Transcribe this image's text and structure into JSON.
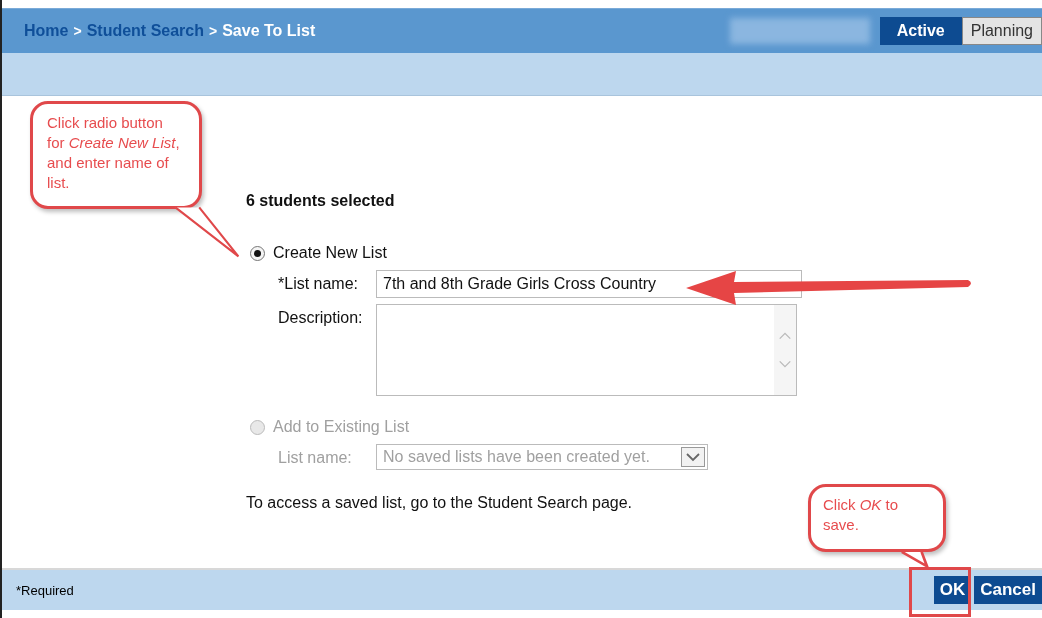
{
  "breadcrumb": {
    "separator": ">",
    "items": [
      {
        "label": "Home",
        "current": false
      },
      {
        "label": "Student Search",
        "current": false
      },
      {
        "label": "Save To List",
        "current": true
      }
    ]
  },
  "mode_tabs": [
    {
      "label": "Active",
      "selected": true
    },
    {
      "label": "Planning",
      "selected": false
    }
  ],
  "selection_count": "6 students selected",
  "options": [
    {
      "kind": "new",
      "label": "Create New List",
      "selected": true,
      "disabled": false,
      "list_name_label": "*List name:",
      "list_name_value": "7th and 8th Grade Girls Cross Country",
      "description_label": "Description:"
    },
    {
      "kind": "existing",
      "label": "Add to Existing List",
      "selected": false,
      "disabled": true,
      "list_name_label": "List name:",
      "list_name_value": "No saved lists have been created yet."
    }
  ],
  "note": "To access a saved list, go to the Student Search page.",
  "footer": {
    "required_note": "*Required",
    "buttons": [
      "OK",
      "Cancel"
    ]
  },
  "annotations": [
    {
      "text": "Click radio button for *Create New List*, and enter name of list."
    },
    {
      "text": "Click *OK* to save."
    }
  ]
}
